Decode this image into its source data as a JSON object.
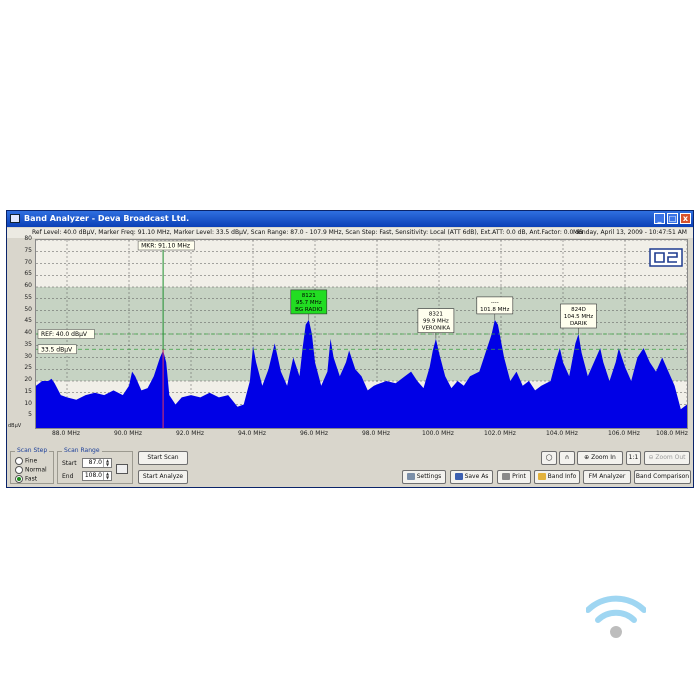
{
  "window": {
    "title": "Band Analyzer - Deva Broadcast Ltd.",
    "minimize": "_",
    "maximize": "□",
    "close": "x"
  },
  "status": {
    "info": "Ref Level: 40.0 dBµV, Marker Freq: 91.10 MHz, Marker Level: 33.5 dBµV, Scan Range: 87.0 - 107.9 MHz, Scan Step: Fast, Sensitivity: Local (ATT 6dB), Ext.ATT: 0.0 dB, Ant.Factor: 0.0 dB",
    "datetime": "Monday, April 13, 2009 - 10:47:51 AM"
  },
  "chart_data": {
    "type": "area",
    "ylabel": "dBµV",
    "ylim": [
      0,
      80
    ],
    "xlim": [
      87.0,
      108.0
    ],
    "y_ticks": [
      5,
      10,
      15,
      20,
      25,
      30,
      35,
      40,
      45,
      50,
      55,
      60,
      65,
      70,
      75,
      80
    ],
    "x_ticks": [
      "88.0 MHz",
      "90.0 MHz",
      "92.0 MHz",
      "94.0 MHz",
      "96.0 MHz",
      "98.0 MHz",
      "100.0 MHz",
      "102.0 MHz",
      "104.0 MHz",
      "106.0 MHz",
      "108.0 MHz"
    ],
    "x_tick_values": [
      88,
      90,
      92,
      94,
      96,
      98,
      100,
      102,
      104,
      106,
      108
    ],
    "shaded_band": [
      20,
      60
    ],
    "ref_level": 40.0,
    "ref_label": "REF: 40.0 dBµV",
    "marker_level": 33.5,
    "marker_level_label": "33.5 dBµV",
    "marker_freq": 91.1,
    "marker_label": "MKR: 91.10 MHz",
    "spectrum": [
      [
        87.0,
        18
      ],
      [
        87.2,
        20
      ],
      [
        87.4,
        20
      ],
      [
        87.5,
        21
      ],
      [
        87.6,
        19
      ],
      [
        87.8,
        14
      ],
      [
        88.0,
        13
      ],
      [
        88.3,
        12
      ],
      [
        88.6,
        14
      ],
      [
        88.9,
        15
      ],
      [
        89.2,
        14
      ],
      [
        89.5,
        16
      ],
      [
        89.8,
        14
      ],
      [
        90.0,
        18
      ],
      [
        90.1,
        24
      ],
      [
        90.2,
        22
      ],
      [
        90.4,
        16
      ],
      [
        90.6,
        17
      ],
      [
        90.8,
        22
      ],
      [
        91.0,
        30
      ],
      [
        91.1,
        33
      ],
      [
        91.2,
        28
      ],
      [
        91.3,
        14
      ],
      [
        91.5,
        10
      ],
      [
        91.7,
        13
      ],
      [
        92.0,
        14
      ],
      [
        92.3,
        13
      ],
      [
        92.6,
        15
      ],
      [
        92.9,
        13
      ],
      [
        93.2,
        14
      ],
      [
        93.5,
        9
      ],
      [
        93.7,
        10
      ],
      [
        93.9,
        20
      ],
      [
        94.0,
        35
      ],
      [
        94.1,
        28
      ],
      [
        94.3,
        18
      ],
      [
        94.5,
        25
      ],
      [
        94.7,
        36
      ],
      [
        94.9,
        24
      ],
      [
        95.1,
        18
      ],
      [
        95.3,
        30
      ],
      [
        95.5,
        22
      ],
      [
        95.6,
        34
      ],
      [
        95.7,
        44
      ],
      [
        95.8,
        46
      ],
      [
        95.9,
        40
      ],
      [
        96.0,
        28
      ],
      [
        96.2,
        18
      ],
      [
        96.4,
        24
      ],
      [
        96.5,
        38
      ],
      [
        96.6,
        30
      ],
      [
        96.8,
        22
      ],
      [
        97.0,
        28
      ],
      [
        97.1,
        33
      ],
      [
        97.3,
        25
      ],
      [
        97.5,
        22
      ],
      [
        97.7,
        16
      ],
      [
        97.9,
        18
      ],
      [
        98.1,
        19
      ],
      [
        98.3,
        20
      ],
      [
        98.6,
        19
      ],
      [
        98.9,
        22
      ],
      [
        99.1,
        24
      ],
      [
        99.3,
        20
      ],
      [
        99.5,
        17
      ],
      [
        99.7,
        26
      ],
      [
        99.8,
        33
      ],
      [
        99.9,
        38
      ],
      [
        100.0,
        32
      ],
      [
        100.2,
        22
      ],
      [
        100.4,
        17
      ],
      [
        100.6,
        20
      ],
      [
        100.8,
        18
      ],
      [
        101.0,
        22
      ],
      [
        101.3,
        24
      ],
      [
        101.5,
        32
      ],
      [
        101.7,
        40
      ],
      [
        101.8,
        46
      ],
      [
        101.9,
        44
      ],
      [
        102.1,
        30
      ],
      [
        102.3,
        20
      ],
      [
        102.5,
        24
      ],
      [
        102.7,
        18
      ],
      [
        102.9,
        20
      ],
      [
        103.1,
        16
      ],
      [
        103.3,
        18
      ],
      [
        103.6,
        20
      ],
      [
        103.8,
        30
      ],
      [
        103.9,
        34
      ],
      [
        104.0,
        28
      ],
      [
        104.2,
        22
      ],
      [
        104.4,
        36
      ],
      [
        104.5,
        40
      ],
      [
        104.6,
        32
      ],
      [
        104.8,
        22
      ],
      [
        105.0,
        28
      ],
      [
        105.2,
        34
      ],
      [
        105.3,
        28
      ],
      [
        105.5,
        20
      ],
      [
        105.7,
        28
      ],
      [
        105.8,
        34
      ],
      [
        106.0,
        26
      ],
      [
        106.2,
        20
      ],
      [
        106.4,
        30
      ],
      [
        106.6,
        34
      ],
      [
        106.8,
        28
      ],
      [
        107.0,
        24
      ],
      [
        107.2,
        30
      ],
      [
        107.4,
        24
      ],
      [
        107.6,
        18
      ],
      [
        107.8,
        8
      ],
      [
        108.0,
        10
      ]
    ],
    "stations": [
      {
        "freq": 95.8,
        "level": 46,
        "lines": [
          "8121",
          "95.7 MHz",
          "BG RADIO"
        ],
        "highlight": true
      },
      {
        "freq": 99.9,
        "level": 38,
        "lines": [
          "8321",
          "99.9 MHz",
          "VERONIKA"
        ],
        "highlight": false
      },
      {
        "freq": 101.8,
        "level": 46,
        "lines": [
          "----",
          "101.8 MHz"
        ],
        "highlight": false
      },
      {
        "freq": 104.5,
        "level": 40,
        "lines": [
          "824D",
          "104.5 MHz",
          "DARIK"
        ],
        "highlight": false
      }
    ]
  },
  "controls": {
    "scan_step": {
      "legend": "Scan Step",
      "options": [
        "Fine",
        "Normal",
        "Fast"
      ],
      "selected": "Fast"
    },
    "scan_range": {
      "legend": "Scan Range",
      "start_label": "Start",
      "start_value": "87.0",
      "end_label": "End",
      "end_value": "108.0"
    },
    "buttons": {
      "start_scan": "Start Scan",
      "start_analyze": "Start Analyze",
      "zoom_in": "Zoom In",
      "one_to_one": "1:1",
      "zoom_out": "Zoom Out",
      "settings": "Settings",
      "save_as": "Save As",
      "print": "Print",
      "band_info": "Band Info",
      "fm_analyzer": "FM Analyzer",
      "band_comparison": "Band Comparison"
    }
  },
  "logo_text": "DB",
  "colors": {
    "spectrum": "#0000e6",
    "band_shade": "#b7c9b7",
    "marker_line": "#1f8f2f",
    "ref_line": "#3aa040",
    "highlight_label": "#22dd22",
    "wifi": "#9fd6f2",
    "wifi_dot": "#bdbdbd"
  }
}
